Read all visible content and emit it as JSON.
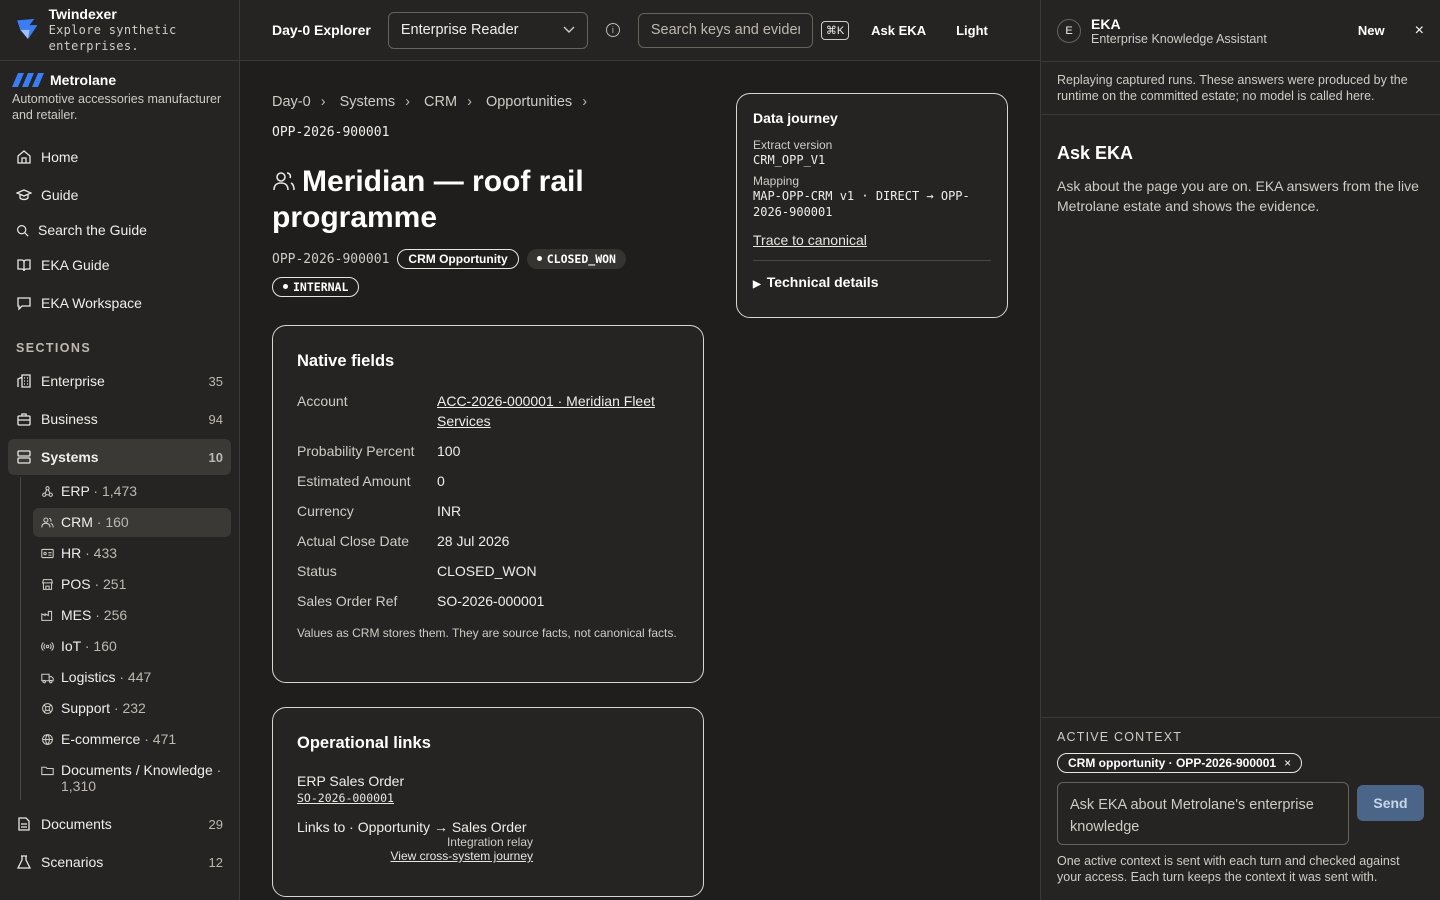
{
  "brand": {
    "name": "Twindexer",
    "tagline": "Explore synthetic enterprises."
  },
  "org": {
    "name": "Metrolane",
    "description": "Automotive accessories manufacturer and retailer."
  },
  "nav": {
    "home": "Home",
    "guide": "Guide",
    "search_guide": "Search the Guide",
    "eka_guide": "EKA Guide",
    "eka_workspace": "EKA Workspace"
  },
  "sections_label": "SECTIONS",
  "sections": {
    "enterprise": {
      "label": "Enterprise",
      "count": "35"
    },
    "business": {
      "label": "Business",
      "count": "94"
    },
    "systems": {
      "label": "Systems",
      "count": "10"
    },
    "documents": {
      "label": "Documents",
      "count": "29"
    },
    "scenarios": {
      "label": "Scenarios",
      "count": "12"
    }
  },
  "systems_children": [
    {
      "label": "ERP",
      "count": " · 1,473",
      "icon": "network-icon"
    },
    {
      "label": "CRM",
      "count": " · 160",
      "icon": "users-icon"
    },
    {
      "label": "HR",
      "count": " · 433",
      "icon": "id-card-icon"
    },
    {
      "label": "POS",
      "count": " · 251",
      "icon": "store-icon"
    },
    {
      "label": "MES",
      "count": " · 256",
      "icon": "factory-icon"
    },
    {
      "label": "IoT",
      "count": " · 160",
      "icon": "signal-icon"
    },
    {
      "label": "Logistics",
      "count": " · 447",
      "icon": "truck-icon"
    },
    {
      "label": "Support",
      "count": " · 232",
      "icon": "lifebuoy-icon"
    },
    {
      "label": "E-commerce",
      "count": " · 471",
      "icon": "globe-icon"
    },
    {
      "label": "Documents / Knowledge",
      "count": " · 1,310",
      "icon": "folder-icon"
    }
  ],
  "topbar": {
    "app_name": "Day-0 Explorer",
    "persona": "Enterprise Reader",
    "search_placeholder": "Search keys and evidence",
    "kbd": "⌘K",
    "ask_eka": "Ask EKA",
    "theme": "Light"
  },
  "breadcrumb": [
    "Day-0",
    "Systems",
    "CRM",
    "Opportunities"
  ],
  "record": {
    "id": "OPP-2026-900001",
    "title": "Meridian — roof rail programme",
    "type_badge": "CRM Opportunity",
    "status_badge": "CLOSED_WON",
    "class_badge": "INTERNAL"
  },
  "native": {
    "title": "Native fields",
    "fields": [
      {
        "label": "Account",
        "value": "ACC-2026-000001 · Meridian Fleet Services"
      },
      {
        "label": "Probability Percent",
        "value": "100"
      },
      {
        "label": "Estimated Amount",
        "value": "0"
      },
      {
        "label": "Currency",
        "value": "INR"
      },
      {
        "label": "Actual Close Date",
        "value": "28 Jul 2026"
      },
      {
        "label": "Status",
        "value": "CLOSED_WON"
      },
      {
        "label": "Sales Order Ref",
        "value": "SO-2026-000001"
      }
    ],
    "note": "Values as CRM stores them. They are source facts, not canonical facts."
  },
  "operational": {
    "title": "Operational links",
    "erp_title": "ERP Sales Order",
    "erp_id": "SO-2026-000001",
    "link_text": "Links to · Opportunity → Sales Order",
    "relay": "Integration relay",
    "journey_link": "View cross-system journey"
  },
  "journey": {
    "title": "Data journey",
    "extract_label": "Extract version",
    "extract_value": "CRM_OPP_V1",
    "mapping_label": "Mapping",
    "mapping_value": "MAP-OPP-CRM v1 · DIRECT → OPP-2026-900001",
    "trace": "Trace to canonical",
    "technical": "Technical details"
  },
  "panel": {
    "avatar": "E",
    "title": "EKA",
    "subtitle": "Enterprise Knowledge Assistant",
    "new": "New",
    "close": "×",
    "replay": "Replaying captured runs. These answers were produced by the runtime on the committed estate; no model is called here.",
    "ask_title": "Ask EKA",
    "ask_desc": "Ask about the page you are on. EKA answers from the live Metrolane estate and shows the evidence.",
    "context_label": "ACTIVE CONTEXT",
    "context_chip": "CRM opportunity · OPP-2026-900001",
    "input_placeholder": "Ask EKA about Metrolane's enterprise knowledge",
    "send": "Send",
    "footer": "One active context is sent with each turn and checked against your access. Each turn keeps the context it was sent with."
  },
  "colors": {
    "background": "#1f1e1c",
    "surface": "#252422",
    "accent": "#4b6588",
    "org_logo": "#3b7df5"
  }
}
